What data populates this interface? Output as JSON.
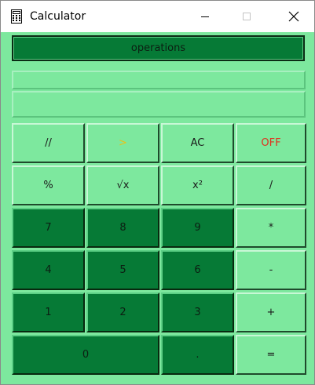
{
  "window": {
    "title": "Calculator"
  },
  "calculator": {
    "operations_label": "operations",
    "expression_display": "",
    "result_display": "",
    "keys": {
      "floor_div": "//",
      "arrow": ">",
      "clear": "AC",
      "off": "OFF",
      "percent": "%",
      "sqrt": "√x",
      "square": "x²",
      "divide": "/",
      "seven": "7",
      "eight": "8",
      "nine": "9",
      "multiply": "*",
      "four": "4",
      "five": "5",
      "six": "6",
      "minus": "-",
      "one": "1",
      "two": "2",
      "three": "3",
      "plus": "+",
      "zero": "0",
      "decimal": ".",
      "equals": "="
    }
  },
  "colors": {
    "background": "#7de89e",
    "dark_key": "#067a36",
    "off_text": "#e0301e",
    "arrow_text": "#e8c21a"
  }
}
